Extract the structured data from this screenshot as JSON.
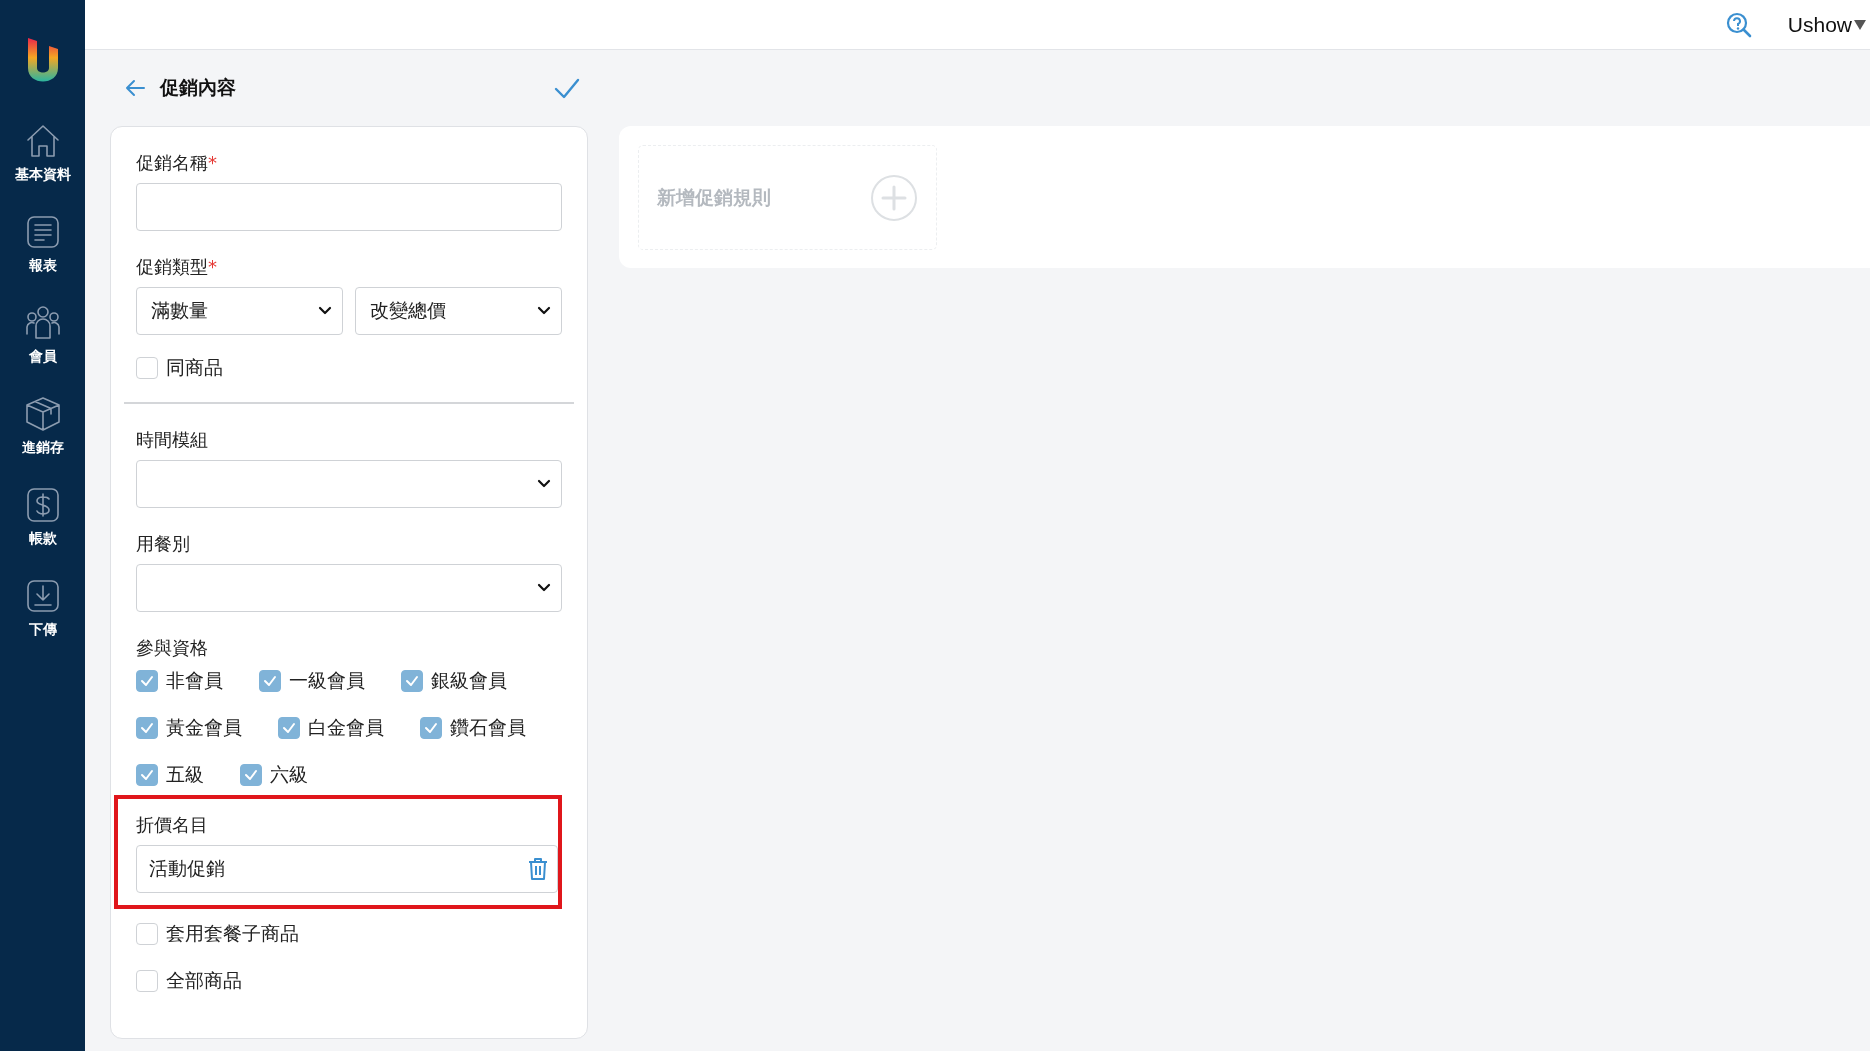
{
  "sidebar": {
    "items": [
      {
        "label": "基本資料",
        "kind": "home"
      },
      {
        "label": "報表",
        "kind": "report"
      },
      {
        "label": "會員",
        "kind": "members"
      },
      {
        "label": "進銷存",
        "kind": "box"
      },
      {
        "label": "帳款",
        "kind": "money"
      },
      {
        "label": "下傳",
        "kind": "download"
      }
    ]
  },
  "topbar": {
    "user": "Ushow"
  },
  "page": {
    "title": "促銷內容"
  },
  "form": {
    "sections": [
      {
        "kind": "text",
        "label": "促銷名稱",
        "required_mark": "*"
      },
      {
        "kind": "selects",
        "label": "促銷類型",
        "required_mark": "*",
        "values": [
          "滿數量",
          "改變總價"
        ]
      },
      {
        "kind": "checkbox",
        "label": "同商品",
        "checked": false
      },
      {
        "kind": "divider"
      },
      {
        "kind": "select",
        "label": "時間模組"
      },
      {
        "kind": "select",
        "label": "用餐別"
      },
      {
        "kind": "checkgroup",
        "label": "參與資格",
        "options": [
          {
            "label": "非會員",
            "checked": true
          },
          {
            "label": "一級會員",
            "checked": true
          },
          {
            "label": "銀級會員",
            "checked": true
          },
          {
            "label": "黃金會員",
            "checked": true
          },
          {
            "label": "白金會員",
            "checked": true
          },
          {
            "label": "鑽石會員",
            "checked": true
          },
          {
            "label": "五級",
            "checked": true
          },
          {
            "label": "六級",
            "checked": true
          }
        ]
      },
      {
        "kind": "tag",
        "label": "折價名目",
        "value": "活動促銷",
        "highlighted": true
      },
      {
        "kind": "checkbox",
        "label": "套用套餐子商品",
        "checked": false
      },
      {
        "kind": "checkbox",
        "label": "全部商品",
        "checked": false
      }
    ]
  },
  "rules": {
    "add_label": "新增促銷規則"
  }
}
